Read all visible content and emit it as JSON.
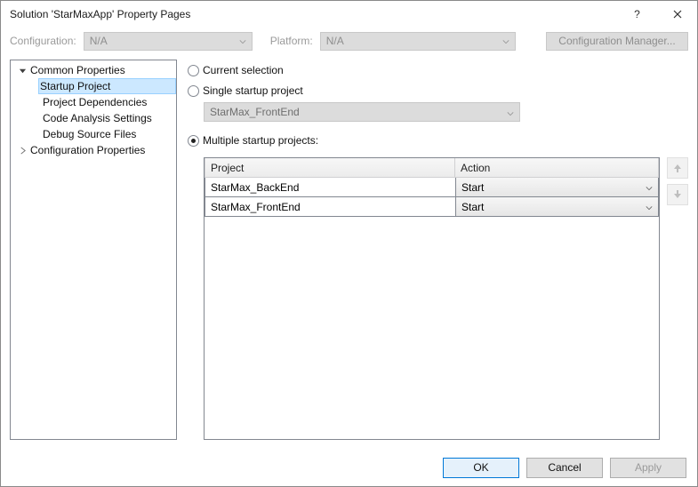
{
  "window": {
    "title": "Solution 'StarMaxApp' Property Pages",
    "help_glyph": "?",
    "close_glyph": "✕"
  },
  "toolbar": {
    "config_label": "Configuration:",
    "config_value": "N/A",
    "platform_label": "Platform:",
    "platform_value": "N/A",
    "config_manager_label": "Configuration Manager..."
  },
  "tree": {
    "common_label": "Common Properties",
    "startup_label": "Startup Project",
    "deps_label": "Project Dependencies",
    "analysis_label": "Code Analysis Settings",
    "debug_label": "Debug Source Files",
    "config_props_label": "Configuration Properties"
  },
  "radios": {
    "current_label": "Current selection",
    "single_label": "Single startup project",
    "single_value": "StarMax_FrontEnd",
    "multiple_label": "Multiple startup projects:"
  },
  "grid": {
    "col_project": "Project",
    "col_action": "Action",
    "rows": [
      {
        "project": "StarMax_BackEnd",
        "action": "Start"
      },
      {
        "project": "StarMax_FrontEnd",
        "action": "Start"
      }
    ]
  },
  "buttons": {
    "ok": "OK",
    "cancel": "Cancel",
    "apply": "Apply"
  }
}
